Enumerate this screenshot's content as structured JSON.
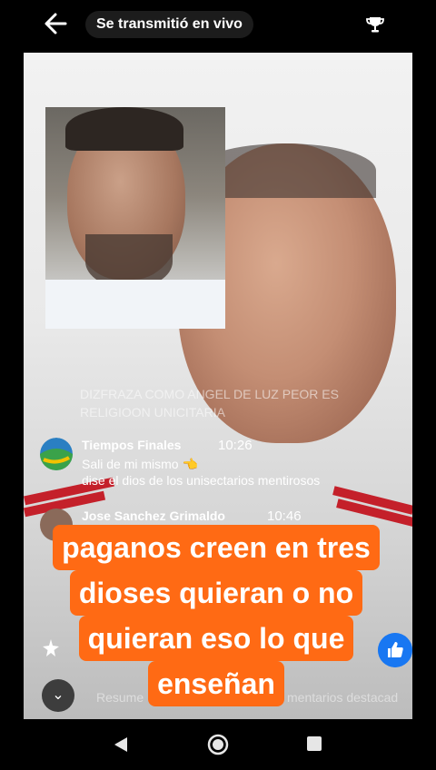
{
  "header": {
    "title": "Se transmitió en vivo",
    "back_icon": "arrow-left-icon",
    "trophy_icon": "trophy-icon"
  },
  "video_overlay": {
    "line1": "DIZFRAZA COMO ANGEL DE LUZ PEOR ES",
    "line2": "RELIGIOON UNICITARIA"
  },
  "comments": [
    {
      "name": "Tiempos Finales",
      "time": "10:26",
      "lines": [
        "Sali de mi mismo 👈",
        "dise el dios de los unisectarios mentirosos"
      ]
    },
    {
      "name": "Jose Sanchez Grimaldo",
      "time": "10:46",
      "lines": []
    }
  ],
  "caption": {
    "lines": [
      "paganos creen en tres",
      "dioses quieran o no",
      "quieran eso lo que",
      "enseñan"
    ],
    "color": "#ff6a14"
  },
  "bottom_bar": {
    "resumen": "Resume",
    "destacados": "mentarios destacad"
  },
  "colors": {
    "like": "#1877f2",
    "background": "#000000"
  }
}
